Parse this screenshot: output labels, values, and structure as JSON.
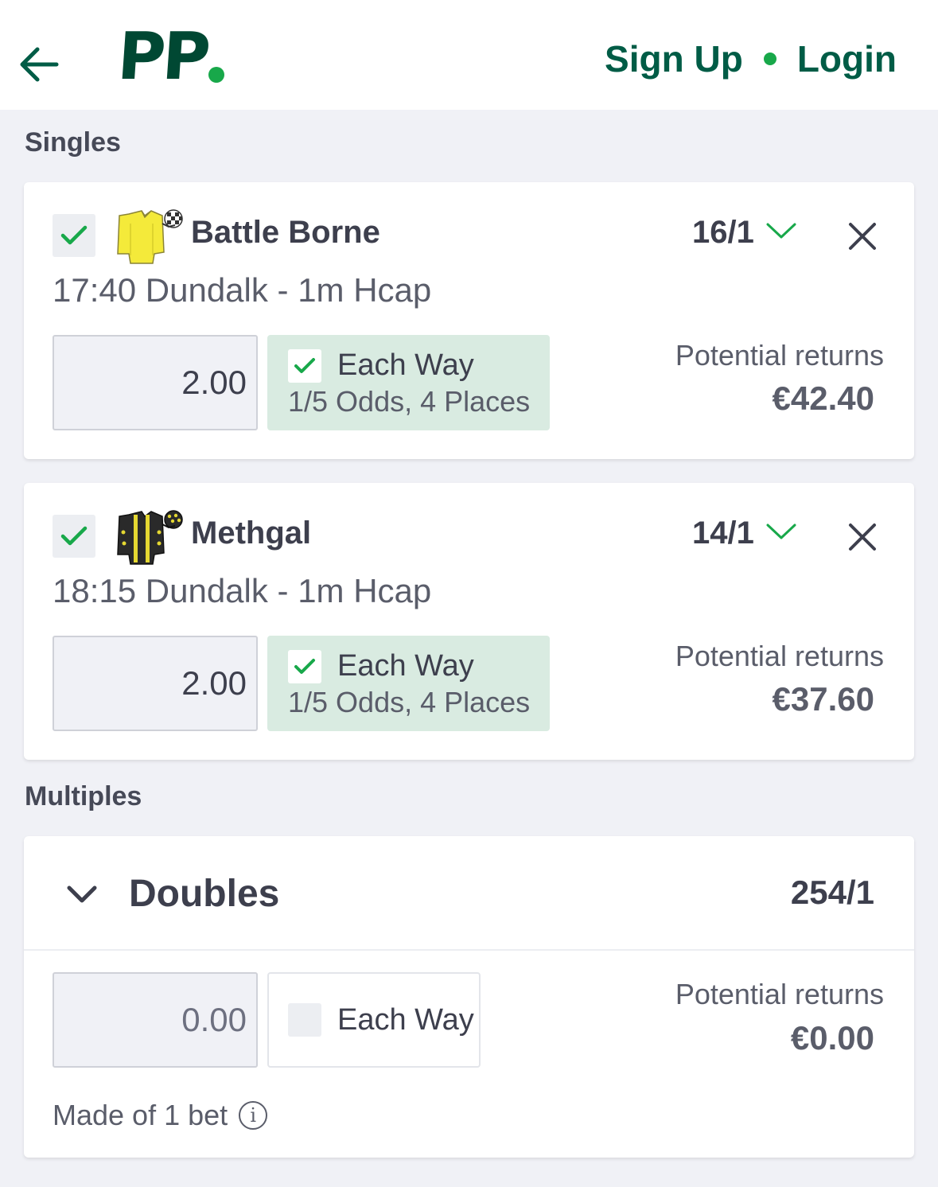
{
  "header": {
    "logo_text": "PP",
    "signup_label": "Sign Up",
    "login_label": "Login"
  },
  "colors": {
    "brand_dark": "#004833",
    "brand_green": "#18a84a",
    "link_green": "#005c46",
    "ew_bg": "#d9ebe1",
    "page_bg": "#f0f1f6"
  },
  "singles": {
    "section_title": "Singles",
    "bets": [
      {
        "selection": "Battle Borne",
        "race": "17:40 Dundalk - 1m Hcap",
        "odds": "16/1",
        "stake": "2.00",
        "each_way_label": "Each Way",
        "each_way_terms": "1/5 Odds, 4 Places",
        "each_way_checked": true,
        "returns_label": "Potential returns",
        "returns_value": "€42.40",
        "silks_icon": "yellow-silks-icon"
      },
      {
        "selection": "Methgal",
        "race": "18:15 Dundalk - 1m Hcap",
        "odds": "14/1",
        "stake": "2.00",
        "each_way_label": "Each Way",
        "each_way_terms": "1/5 Odds, 4 Places",
        "each_way_checked": true,
        "returns_label": "Potential returns",
        "returns_value": "€37.60",
        "silks_icon": "black-yellow-silks-icon"
      }
    ]
  },
  "multiples": {
    "section_title": "Multiples",
    "doubles": {
      "title": "Doubles",
      "odds": "254/1",
      "stake_placeholder": "0.00",
      "each_way_label": "Each Way",
      "each_way_checked": false,
      "returns_label": "Potential returns",
      "returns_value": "€0.00",
      "made_of": "Made of 1 bet"
    }
  }
}
